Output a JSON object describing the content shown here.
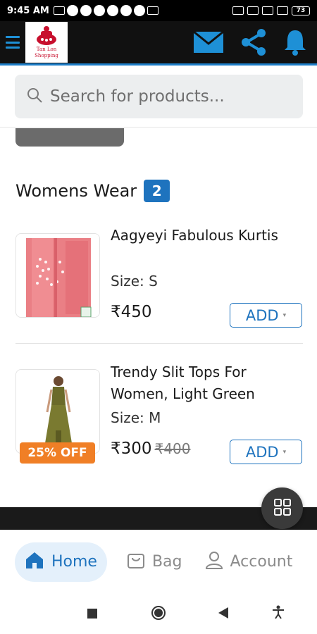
{
  "status_bar": {
    "time": "9:45 AM",
    "battery": "73"
  },
  "app": {
    "logo_line1": "Tan Lon",
    "logo_line2": "Shopping"
  },
  "search": {
    "placeholder": "Search for products..."
  },
  "section": {
    "title": "Womens Wear",
    "count": "2"
  },
  "products": [
    {
      "name": "Aagyeyi Fabulous Kurtis",
      "size": "Size: S",
      "price": "₹450",
      "add_label": "ADD"
    },
    {
      "name": "Trendy Slit Tops For Women, Light Green",
      "size": "Size: M",
      "price": "₹300",
      "original_price": "₹400",
      "discount": "25% OFF",
      "add_label": "ADD"
    }
  ],
  "bottom_nav": {
    "home": "Home",
    "bag": "Bag",
    "account": "Account"
  },
  "colors": {
    "accent": "#1e73be",
    "discount": "#f07f26",
    "header": "#111111"
  },
  "icons": [
    "menu-icon",
    "mail-icon",
    "share-icon",
    "bell-icon",
    "search-icon",
    "grid-icon",
    "home-icon",
    "bag-icon",
    "account-icon"
  ]
}
